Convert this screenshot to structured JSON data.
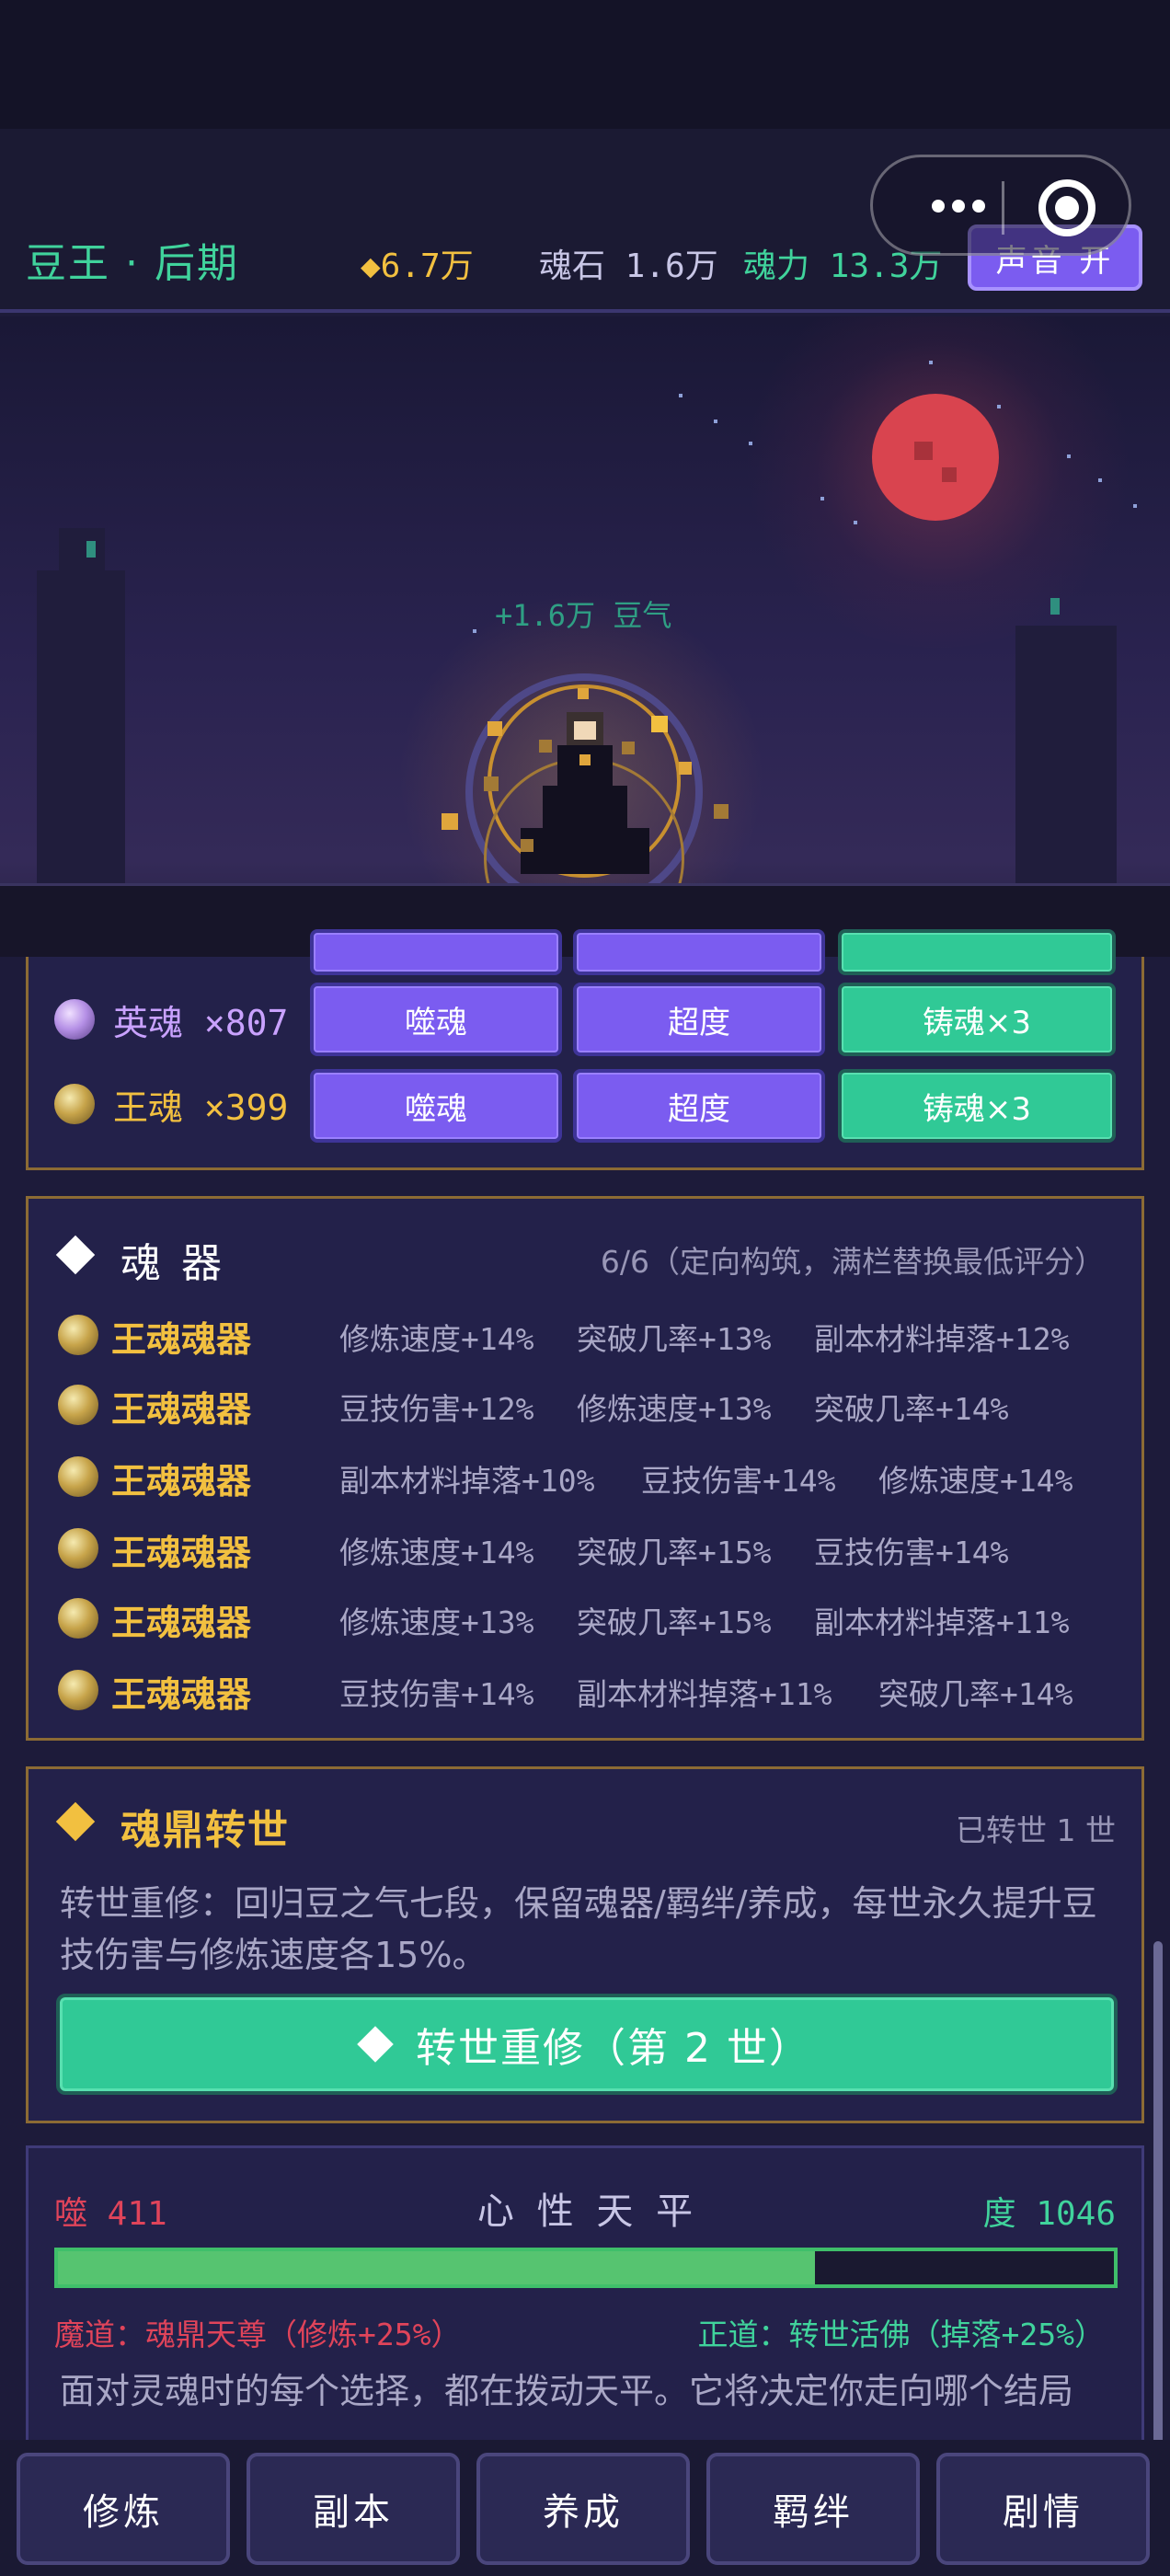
{
  "header": {
    "realm": "豆王 · 后期",
    "gold": "◆6.7万",
    "soul_stone": "魂石 1.6万",
    "soul_power": "魂力 13.3万",
    "sound_button": "声音 开"
  },
  "scene": {
    "float_text": "+1.6万 豆气"
  },
  "souls": [
    {
      "name": "英魂 ×807",
      "color": "#c9a2ff",
      "orb": "purple-orb-icon",
      "actions": [
        "噬魂",
        "超度",
        "铸魂×3"
      ]
    },
    {
      "name": "王魂 ×399",
      "color": "#f2c040",
      "orb": "gold-orb-icon",
      "actions": [
        "噬魂",
        "超度",
        "铸魂×3"
      ]
    }
  ],
  "artifacts": {
    "title": "魂 器",
    "meta": "6/6（定向构筑，满栏替换最低评分）",
    "items": [
      {
        "name": "王魂魂器",
        "stats": [
          "修炼速度+14%",
          "突破几率+13%",
          "副本材料掉落+12%"
        ]
      },
      {
        "name": "王魂魂器",
        "stats": [
          "豆技伤害+12%",
          "修炼速度+13%",
          "突破几率+14%"
        ]
      },
      {
        "name": "王魂魂器",
        "stats": [
          "副本材料掉落+10%",
          "豆技伤害+14%",
          "修炼速度+14%"
        ]
      },
      {
        "name": "王魂魂器",
        "stats": [
          "修炼速度+14%",
          "突破几率+15%",
          "豆技伤害+14%"
        ]
      },
      {
        "name": "王魂魂器",
        "stats": [
          "修炼速度+13%",
          "突破几率+15%",
          "副本材料掉落+11%"
        ]
      },
      {
        "name": "王魂魂器",
        "stats": [
          "豆技伤害+14%",
          "副本材料掉落+11%",
          "突破几率+14%"
        ]
      }
    ]
  },
  "rebirth": {
    "title": "魂鼎转世",
    "meta": "已转世 1 世",
    "description": "转世重修：回归豆之气七段，保留魂器/羁绊/养成，每世永久提升豆技伤害与修炼速度各15%。",
    "button": "转世重修（第 2 世）"
  },
  "balance": {
    "left_label": "噬 411",
    "title": "心 性 天 平",
    "right_label": "度 1046",
    "fill_fraction": 0.717,
    "left_path": "魔道：魂鼎天尊（修炼+25%）",
    "right_path": "正道：转世活佛（掉落+25%）",
    "description": "面对灵魂时的每个选择，都在拨动天平。它将决定你走向哪个结局"
  },
  "nav": {
    "items": [
      "修炼",
      "副本",
      "养成",
      "羁绊",
      "剧情"
    ]
  },
  "colors": {
    "accent_green": "#30c996",
    "accent_purple": "#7b5cf0",
    "gold": "#f2c040",
    "red": "#e0445a"
  }
}
